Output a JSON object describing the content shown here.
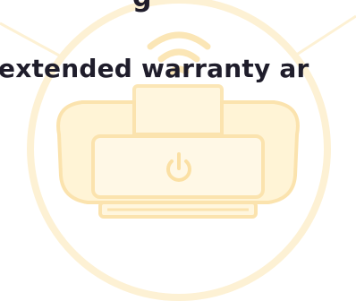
{
  "heading": {
    "top_text": "g",
    "main_text": "extended warranty ar"
  },
  "illustration": {
    "icon": "printer-icon",
    "wifi_icon": "wifi-icon",
    "power_icon": "power-icon",
    "circle_color": "#fdf3dc",
    "line_color": "#fbe9c0",
    "icon_fill": "#fff4d6",
    "icon_stroke": "#fbe3ae"
  }
}
